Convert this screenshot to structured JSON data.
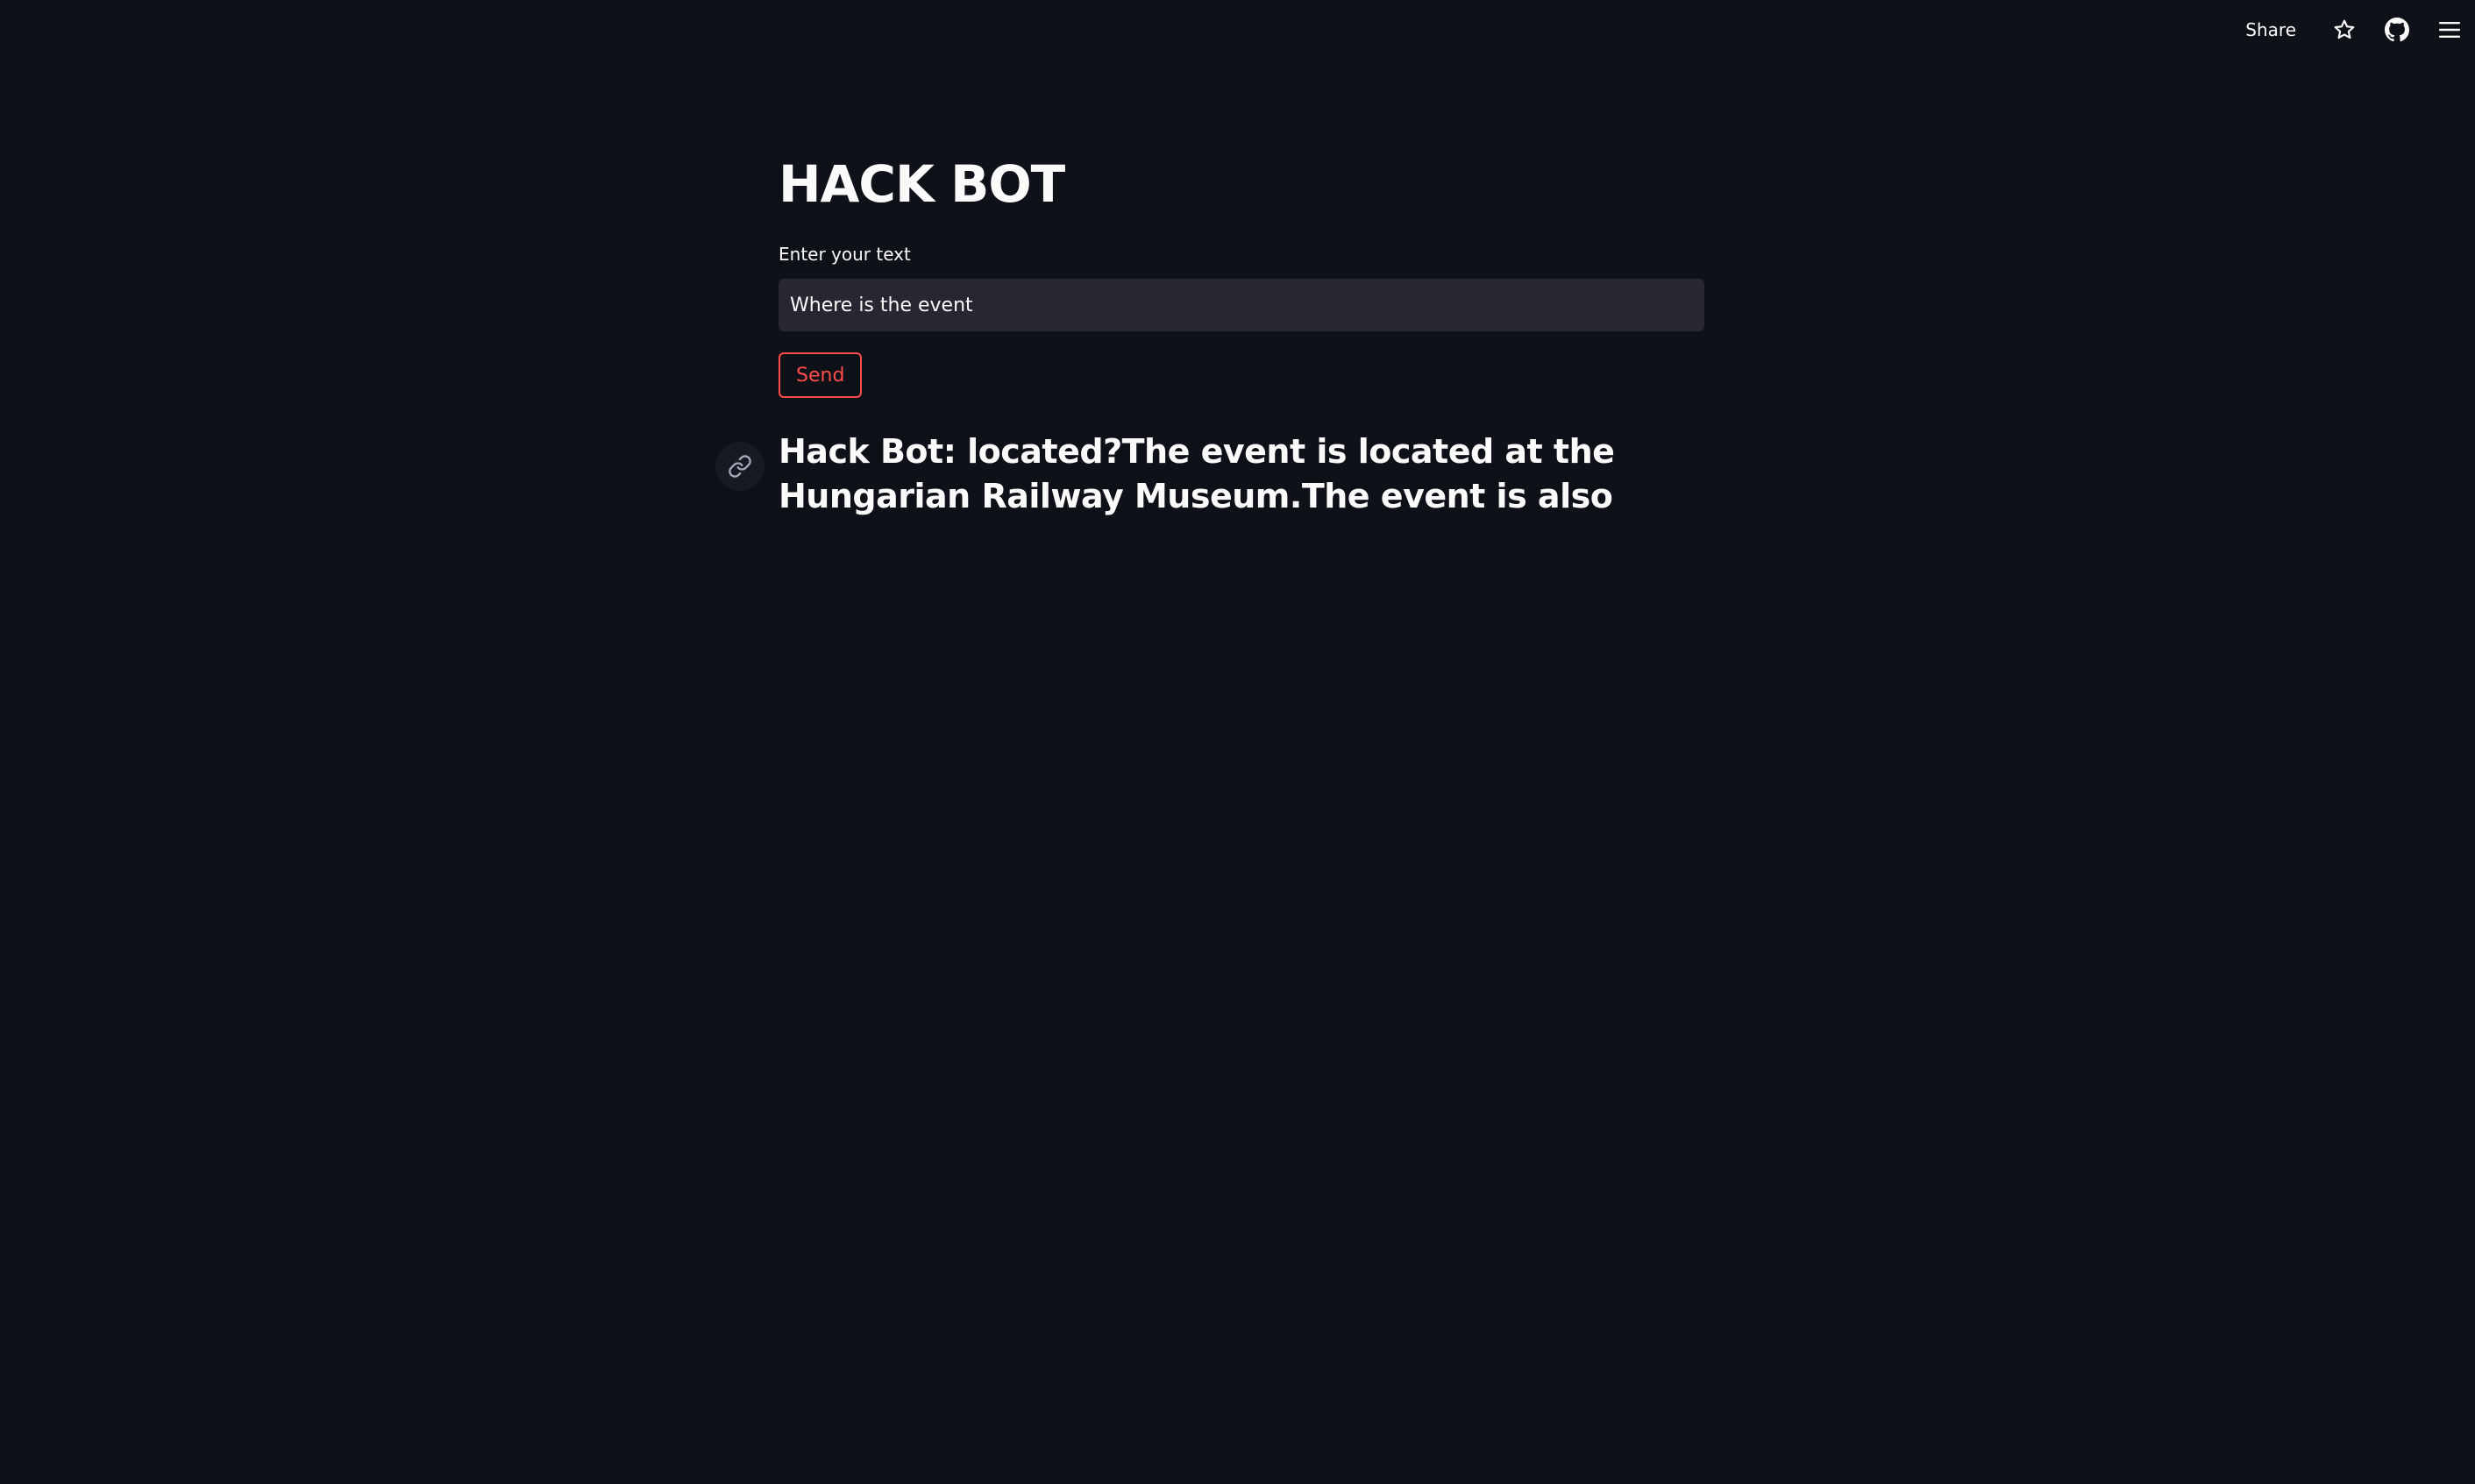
{
  "header": {
    "share_label": "Share",
    "icons": [
      "star-icon",
      "github-icon",
      "hamburger-menu-icon"
    ]
  },
  "main": {
    "title": "HACK BOT",
    "input_label": "Enter your text",
    "input_value": "Where is the event",
    "send_label": "Send",
    "response": "Hack Bot: located?The event is located at the Hungarian Railway Museum.The event is also"
  },
  "colors": {
    "background": "#0e1117",
    "input_background": "#262730",
    "accent": "#ff4b4b",
    "text": "#fafafa"
  }
}
